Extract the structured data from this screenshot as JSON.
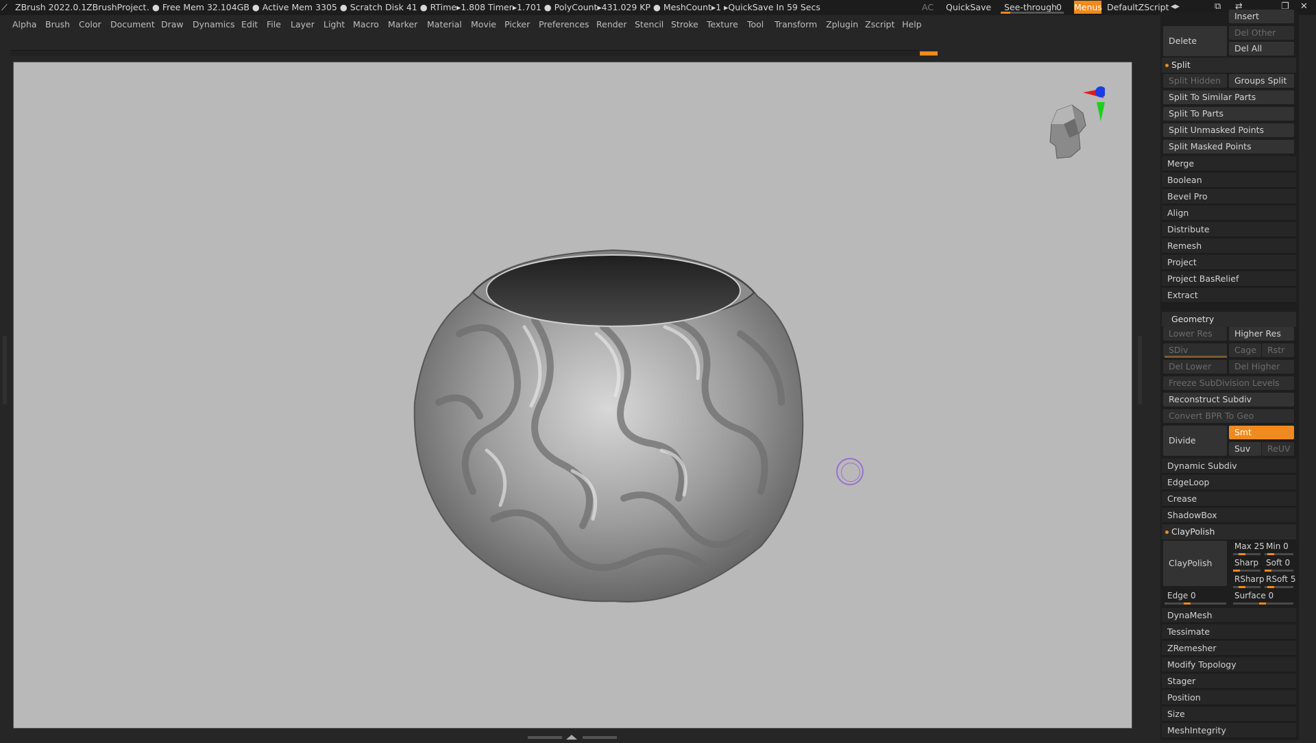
{
  "titlebar": {
    "app": "ZBrush 2022.0.1",
    "project": "ZBrushProject",
    "stats": ". ● Free Mem 32.104GB ● Active Mem 3305 ● Scratch Disk 41 ● RTime▸1.808 Timer▸1.701 ● PolyCount▸431.029 KP ● MeshCount▸1 ▸QuickSave In 59 Secs",
    "ac": "AC",
    "quicksave": "QuickSave",
    "see_through_label": "See-through",
    "see_through_value": "0",
    "menus": "Menus",
    "script": "DefaultZScript"
  },
  "menu": [
    "Alpha",
    "Brush",
    "Color",
    "Document",
    "Draw",
    "Dynamics",
    "Edit",
    "File",
    "Layer",
    "Light",
    "Macro",
    "Marker",
    "Material",
    "Movie",
    "Picker",
    "Preferences",
    "Render",
    "Stencil",
    "Stroke",
    "Texture",
    "Tool",
    "Transform",
    "Zplugin",
    "Zscript",
    "Help"
  ],
  "panel": {
    "insert": "Insert",
    "delete": "Delete",
    "del_other": "Del Other",
    "del_all": "Del All",
    "split_header": "Split",
    "split_hidden": "Split Hidden",
    "groups_split": "Groups Split",
    "split_similar": "Split To Similar Parts",
    "split_parts": "Split To Parts",
    "split_unmasked": "Split Unmasked Points",
    "split_masked": "Split Masked Points",
    "subtool_rows": [
      "Merge",
      "Boolean",
      "Bevel Pro",
      "Align",
      "Distribute",
      "Remesh",
      "Project",
      "Project BasRelief",
      "Extract"
    ],
    "geometry_header": "Geometry",
    "lower_res": "Lower Res",
    "higher_res": "Higher Res",
    "sdiv": "SDiv",
    "cage": "Cage",
    "rstr": "Rstr",
    "del_lower": "Del Lower",
    "del_higher": "Del Higher",
    "freeze": "Freeze SubDivision Levels",
    "reconstruct": "Reconstruct Subdiv",
    "convert_bpr": "Convert BPR To Geo",
    "divide": "Divide",
    "smt": "Smt",
    "suv": "Suv",
    "reuv": "ReUV",
    "geo_rows1": [
      "Dynamic Subdiv",
      "EdgeLoop",
      "Crease",
      "ShadowBox"
    ],
    "claypolish_header": "ClayPolish",
    "claypolish_btn": "ClayPolish",
    "max": "Max 25",
    "min": "Min 0",
    "sharp": "Sharp",
    "soft": "Soft 0",
    "rsharp": "RSharp",
    "rsoft": "RSoft 5",
    "edge": "Edge 0",
    "surface": "Surface 0",
    "geo_rows2": [
      "DynaMesh",
      "Tessimate",
      "ZRemesher",
      "Modify Topology",
      "Stager",
      "Position",
      "Size",
      "MeshIntegrity"
    ]
  }
}
